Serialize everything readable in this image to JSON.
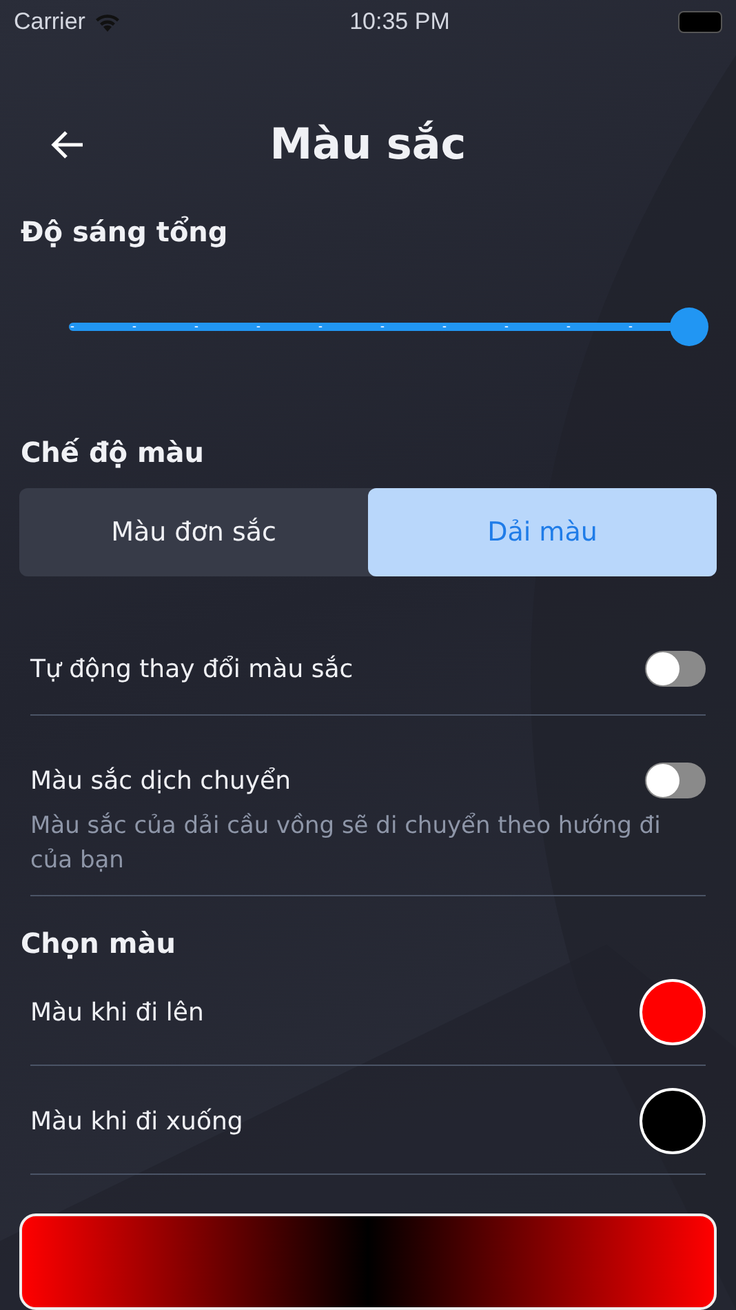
{
  "status_bar": {
    "carrier": "Carrier",
    "time": "10:35 PM"
  },
  "header": {
    "title": "Màu sắc"
  },
  "brightness": {
    "title": "Độ sáng tổng",
    "level": 1.0
  },
  "color_mode": {
    "title": "Chế độ màu",
    "options": [
      {
        "label": "Màu đơn sắc",
        "selected": false
      },
      {
        "label": "Dải màu",
        "selected": true
      }
    ]
  },
  "toggles": [
    {
      "label": "Tự động thay đổi màu sắc",
      "on": false
    },
    {
      "label": "Màu sắc dịch chuyển",
      "description": "Màu sắc của dải cầu vồng sẽ di chuyển theo hướng đi của bạn",
      "on": false
    }
  ],
  "color_pick": {
    "title": "Chọn màu",
    "items": [
      {
        "label": "Màu khi đi lên",
        "color": "#ff0000"
      },
      {
        "label": "Màu khi đi xuống",
        "color": "#000000"
      }
    ]
  }
}
